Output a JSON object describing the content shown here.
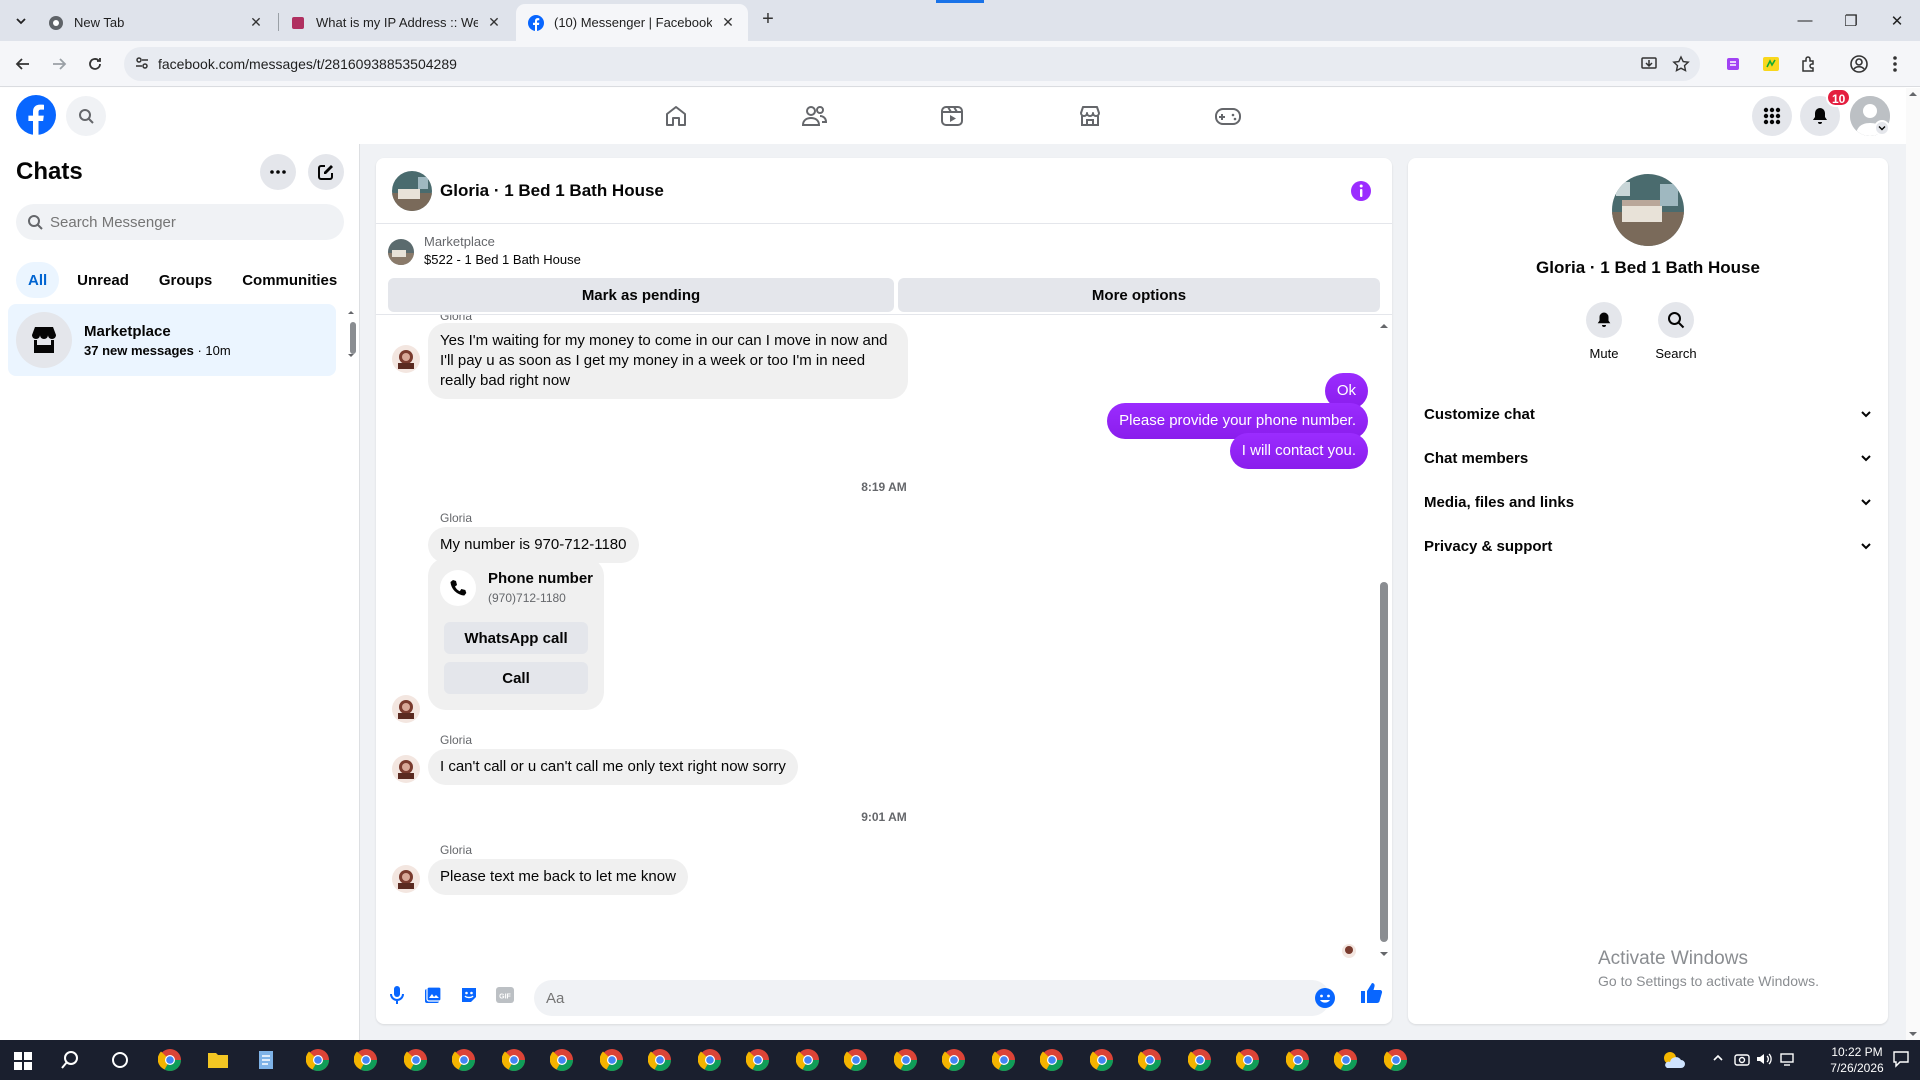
{
  "browser": {
    "tabs": [
      {
        "title": "New Tab"
      },
      {
        "title": "What is my IP Address :: WebBr"
      },
      {
        "title": "(10) Messenger | Facebook"
      }
    ],
    "url": "facebook.com/messages/t/28160938853504289"
  },
  "header": {
    "notification_count": "10"
  },
  "chats": {
    "title": "Chats",
    "search_placeholder": "Search Messenger",
    "filters": [
      "All",
      "Unread",
      "Groups",
      "Communities"
    ],
    "active_filter": "All",
    "items": [
      {
        "name": "Marketplace",
        "preview_bold": "37 new messages",
        "time": " · 10m"
      }
    ]
  },
  "conversation": {
    "title": "Gloria · 1 Bed 1 Bath House",
    "marketplace_label": "Marketplace",
    "marketplace_item": "$522 - 1 Bed 1 Bath House",
    "mark_pending": "Mark as pending",
    "more_options": "More options",
    "messages": {
      "top_sender": "Gloria",
      "m1": "Yes I'm waiting for my money to come in our can I move in now and I'll pay u as soon as I get my money in a week or too I'm in need really bad right now",
      "o1": "Ok",
      "o2": "Please provide your phone number.",
      "o3": "I will contact you.",
      "t1": "8:19 AM",
      "sender2": "Gloria",
      "m2": "My number is 970-712-1180",
      "card_title": "Phone number",
      "card_number": "(970)712-1180",
      "whatsapp_call": "WhatsApp call",
      "call": "Call",
      "sender3": "Gloria",
      "m3": "I can't call or u can't call me only text right now sorry",
      "t2": "9:01 AM",
      "sender4": "Gloria",
      "m4": "Please text me back to let me know"
    },
    "composer_placeholder": "Aa"
  },
  "details": {
    "name": "Gloria · 1 Bed 1 Bath House",
    "actions": [
      "Mute",
      "Search"
    ],
    "sections": [
      "Customize chat",
      "Chat members",
      "Media, files and links",
      "Privacy & support"
    ]
  },
  "watermark": {
    "line1": "Activate Windows",
    "line2": "Go to Settings to activate Windows."
  },
  "taskbar": {
    "time": "10:22 PM",
    "date": "7/26/2026"
  },
  "colors": {
    "accent": "#0866ff",
    "outgoing_bubble": "#9b2cff",
    "badge": "#e41e3f"
  }
}
